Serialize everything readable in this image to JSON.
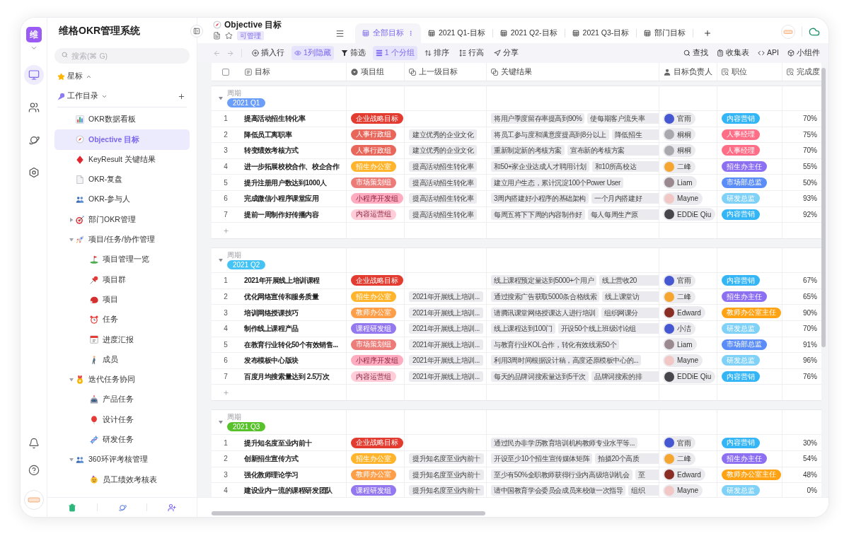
{
  "rail": {
    "logo": "维",
    "nav": [
      {
        "selected": true
      },
      {
        "selected": false
      },
      {
        "selected": false
      },
      {
        "selected": false
      }
    ]
  },
  "sidebar": {
    "title": "维格OKR管理系统",
    "search": {
      "placeholder": "搜索(⌘ G)"
    },
    "starred": {
      "label": "星标",
      "expanded": false
    },
    "workspace": {
      "label": "工作目录",
      "expanded": true
    },
    "items": [
      {
        "label": "OKR数据看板",
        "selected": false
      },
      {
        "label": "Objective 目标",
        "selected": true
      },
      {
        "label": "KeyResult 关键结果",
        "selected": false
      },
      {
        "label": "OKR-复盘",
        "selected": false
      },
      {
        "label": "OKR-参与人",
        "selected": false
      },
      {
        "label": "部门OKR管理",
        "selected": false,
        "expanded": false
      },
      {
        "label": "项目/任务/协作管理",
        "selected": false,
        "expanded": true,
        "children": [
          {
            "label": "项目管理一览",
            "selected": false
          },
          {
            "label": "项目群",
            "selected": false
          },
          {
            "label": "项目",
            "selected": false
          },
          {
            "label": "任务",
            "selected": false
          },
          {
            "label": "进度汇报",
            "selected": false
          },
          {
            "label": "成员",
            "selected": false
          }
        ]
      },
      {
        "label": "迭代任务协同",
        "selected": false,
        "expanded": true,
        "children": [
          {
            "label": "产品任务",
            "selected": false
          },
          {
            "label": "设计任务",
            "selected": false
          },
          {
            "label": "研发任务",
            "selected": false
          }
        ]
      },
      {
        "label": "360环评考核管理",
        "selected": false,
        "expanded": true,
        "children": [
          {
            "label": "员工绩效考核表",
            "selected": false
          }
        ]
      }
    ]
  },
  "header": {
    "title": "Objective 目标",
    "badge": "可管理",
    "tabs": [
      {
        "label": "全部目标",
        "selected": true
      },
      {
        "label": "2021 Q1-目标",
        "selected": false
      },
      {
        "label": "2021 Q2-目标",
        "selected": false
      },
      {
        "label": "2021 Q3-目标",
        "selected": false
      },
      {
        "label": "部门目标",
        "selected": false
      }
    ]
  },
  "toolbar": {
    "history": [
      {
        "disabled": true
      },
      {
        "disabled": true
      }
    ],
    "left": [
      {
        "label": "插入行",
        "active": false
      },
      {
        "label": "1列隐藏",
        "active": true
      },
      {
        "label": "筛选",
        "active": false
      },
      {
        "label": "1 个分组",
        "active": true
      },
      {
        "label": "排序",
        "active": false
      },
      {
        "label": "行高",
        "active": false
      },
      {
        "label": "分享",
        "active": false
      }
    ],
    "right": [
      "查找",
      "收集表",
      "API",
      "小组件"
    ]
  },
  "table": {
    "select_all": {
      "checked": false
    },
    "columns": [
      "目标",
      "项目组",
      "上一级目标",
      "关键结果",
      "目标负责人",
      "职位",
      "完成度"
    ],
    "groups": [
      {
        "field": "周期",
        "label": "2021 Q1",
        "color": "#6b9ef8",
        "expanded": true,
        "rows": [
          {
            "no": "1",
            "objective": "提高活动招生转化率",
            "team": {
              "label": "企业战略目标",
              "color": "#e33b30"
            },
            "key_results": [
              "将用户季度留存率提高到90%",
              "使每期客户流失率"
            ],
            "owner": {
              "name": "官雨",
              "color": "#4657d2"
            },
            "position": {
              "label": "内容营销",
              "color": "#34b5f5"
            },
            "completion": "70%"
          },
          {
            "no": "2",
            "objective": "降低员工离职率",
            "team": {
              "label": "人事行政组",
              "color": "#e8675a"
            },
            "parent": "建立优秀的企业文化",
            "key_results": [
              "将员工参与度和满意度提高到8分以上",
              "降低招生"
            ],
            "owner": {
              "name": "桐桐",
              "color": "#a9a9ae"
            },
            "position": {
              "label": "人事经理",
              "color": "#ff6e87"
            },
            "completion": "75%"
          },
          {
            "no": "3",
            "objective": "转变绩效考核方式",
            "team": {
              "label": "人事行政组",
              "color": "#e8675a"
            },
            "parent": "建立优秀的企业文化",
            "key_results": [
              "重新制定新的考核方案",
              "宣布新的考核方案"
            ],
            "owner": {
              "name": "桐桐",
              "color": "#a9a9ae"
            },
            "position": {
              "label": "人事经理",
              "color": "#ff6e87"
            },
            "completion": "70%"
          },
          {
            "no": "4",
            "objective": "进一步拓展校校合作、校企合作",
            "team": {
              "label": "招生办公室",
              "color": "#ffb42b"
            },
            "parent": "提高活动招生转化率",
            "key_results": [
              "和50+家企业达成人才聘用计划",
              "和10所高校达"
            ],
            "owner": {
              "name": "二峰",
              "color": "#f4a630"
            },
            "position": {
              "label": "招生办主任",
              "color": "#8d6ff2"
            },
            "completion": "55%"
          },
          {
            "no": "5",
            "objective": "提升注册用户数达到1000人",
            "team": {
              "label": "市场策划组",
              "color": "#ec7c78"
            },
            "parent": "提高活动招生转化率",
            "key_results": [
              "建立用户生态，累计沉淀100个Power User"
            ],
            "owner": {
              "name": "Liam",
              "color": "#9a8a90"
            },
            "position": {
              "label": "市场部总监",
              "color": "#5a8df7"
            },
            "completion": "50%"
          },
          {
            "no": "6",
            "objective": "完成微信小程序课堂应用",
            "team": {
              "label": "小程序开发组",
              "color": "#ffabc0"
            },
            "parent": "提高活动招生转化率",
            "key_results": [
              "3周内搭建好小程序的基础架构",
              "一个月内搭建好"
            ],
            "owner": {
              "name": "Mayne",
              "color": "#f1c8c6"
            },
            "position": {
              "label": "研发总监",
              "color": "#80d1f8"
            },
            "completion": "93%"
          },
          {
            "no": "7",
            "objective": "提前一周制作好传播内容",
            "team": {
              "label": "内容运营组",
              "color": "#ffccd8"
            },
            "parent": "提高活动招生转化率",
            "key_results": [
              "每周五将下下周的内容制作好",
              "每人每周生产原"
            ],
            "owner": {
              "name": "EDDiE Qiu",
              "color": "#47474b"
            },
            "position": {
              "label": "内容营销",
              "color": "#34b5f5"
            },
            "completion": "92%"
          }
        ]
      },
      {
        "field": "周期",
        "label": "2021 Q2",
        "color": "#45c3f5",
        "expanded": true,
        "rows": [
          {
            "no": "1",
            "objective": "2021年开展线上培训课程",
            "team": {
              "label": "企业战略目标",
              "color": "#e33b30"
            },
            "key_results": [
              "线上课程预定量达到5000+个用户",
              "线上营收20"
            ],
            "owner": {
              "name": "官雨",
              "color": "#4657d2"
            },
            "position": {
              "label": "内容营销",
              "color": "#34b5f5"
            },
            "completion": "67%"
          },
          {
            "no": "2",
            "objective": "优化网络宣传和服务质量",
            "team": {
              "label": "招生办公室",
              "color": "#ffb42b"
            },
            "parent": "2021年开展线上培训...",
            "key_results": [
              "通过搜索广告获取5000条合格线索",
              "线上课堂访"
            ],
            "owner": {
              "name": "二峰",
              "color": "#f4a630"
            },
            "position": {
              "label": "招生办主任",
              "color": "#8d6ff2"
            },
            "completion": "65%"
          },
          {
            "no": "3",
            "objective": "培训网络授课技巧",
            "team": {
              "label": "教师办公室",
              "color": "#ff9e48"
            },
            "parent": "2021年开展线上培训...",
            "key_results": [
              "请腾讯课堂网络授课达人进行培训",
              "组织网课分"
            ],
            "owner": {
              "name": "Edward",
              "color": "#8a2d24"
            },
            "position": {
              "label": "教师办公室主任",
              "color": "#ffa315"
            },
            "completion": "90%"
          },
          {
            "no": "4",
            "objective": "制作线上课程产品",
            "team": {
              "label": "课程研发组",
              "color": "#9478f0"
            },
            "parent": "2021年开展线上培训...",
            "key_results": [
              "线上课程达到100门",
              "开设50个线上班级讨论组"
            ],
            "owner": {
              "name": "小洁",
              "color": "#4657d2"
            },
            "position": {
              "label": "研发总监",
              "color": "#80d1f8"
            },
            "completion": "70%"
          },
          {
            "no": "5",
            "objective": "在教育行业转化50个有效销售...",
            "team": {
              "label": "市场策划组",
              "color": "#ec7c78"
            },
            "parent": "2021年开展线上培训...",
            "key_results": [
              "与教育行业KOL合作，转化有效线索50个"
            ],
            "owner": {
              "name": "Liam",
              "color": "#9a8a90"
            },
            "position": {
              "label": "市场部总监",
              "color": "#5a8df7"
            },
            "completion": "91%"
          },
          {
            "no": "6",
            "objective": "发布模板中心版块",
            "team": {
              "label": "小程序开发组",
              "color": "#ffabc0"
            },
            "parent": "2021年开展线上培训...",
            "key_results": [
              "利用3周时间根据设计稿，高度还原模板中心的..."
            ],
            "owner": {
              "name": "Mayne",
              "color": "#f1c8c6"
            },
            "position": {
              "label": "研发总监",
              "color": "#80d1f8"
            },
            "completion": "96%"
          },
          {
            "no": "7",
            "objective": "百度月均搜索量达到 2.5万次",
            "team": {
              "label": "内容运营组",
              "color": "#ffccd8"
            },
            "parent": "2021年开展线上培训...",
            "key_results": [
              "每天的品牌词搜索量达到5千次",
              "品牌词搜索的排"
            ],
            "owner": {
              "name": "EDDiE Qiu",
              "color": "#47474b"
            },
            "position": {
              "label": "内容营销",
              "color": "#34b5f5"
            },
            "completion": "76%"
          }
        ]
      },
      {
        "field": "周期",
        "label": "2021 Q3",
        "color": "#57c22b",
        "expanded": true,
        "rows": [
          {
            "no": "1",
            "objective": "提升知名度至业内前十",
            "team": {
              "label": "企业战略目标",
              "color": "#e33b30"
            },
            "key_results": [
              "通过民办非学历教育培训机构教师专业水平等..."
            ],
            "owner": {
              "name": "官雨",
              "color": "#4657d2"
            },
            "position": {
              "label": "内容营销",
              "color": "#34b5f5"
            },
            "completion": "30%"
          },
          {
            "no": "2",
            "objective": "创新招生宣传方式",
            "team": {
              "label": "招生办公室",
              "color": "#ffb42b"
            },
            "parent": "提升知名度至业内前十",
            "key_results": [
              "开设至少10个招生宣传媒体矩阵",
              "拍摄20个高质"
            ],
            "owner": {
              "name": "二峰",
              "color": "#f4a630"
            },
            "position": {
              "label": "招生办主任",
              "color": "#8d6ff2"
            },
            "completion": "54%"
          },
          {
            "no": "3",
            "objective": "强化教师理论学习",
            "team": {
              "label": "教师办公室",
              "color": "#ff9e48"
            },
            "parent": "提升知名度至业内前十",
            "key_results": [
              "至少有50%全职教师获得行业内高级培训机会",
              "至"
            ],
            "owner": {
              "name": "Edward",
              "color": "#8a2d24"
            },
            "position": {
              "label": "教师办公室主任",
              "color": "#ffa315"
            },
            "completion": "48%"
          },
          {
            "no": "4",
            "objective": "建设业内一流的课程研发团队",
            "team": {
              "label": "课程研发组",
              "color": "#9478f0"
            },
            "parent": "提升知名度至业内前十",
            "key_results": [
              "请中国教育学会委员会成员来校做一次指导",
              "组织"
            ],
            "owner": {
              "name": "Mayne",
              "color": "#f1c8c6"
            },
            "position": {
              "label": "研发总监",
              "color": "#80d1f8"
            },
            "completion": "0%"
          }
        ]
      }
    ]
  }
}
